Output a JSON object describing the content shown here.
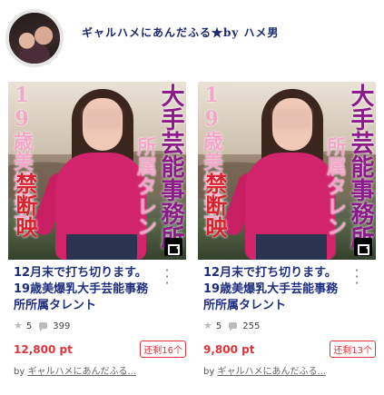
{
  "header": {
    "shop_name": "ギャルハメにあんだふる★by ハメ男"
  },
  "items": [
    {
      "image_overlay": {
        "left_top": "19",
        "left_top2": "歳美爆美女",
        "left_bottom": "禁断映",
        "right_top": "大手芸能事務所",
        "right_mid": "所属タレン"
      },
      "title": "12月末で打ち切ります。19歳美爆乳大手芸能事務所所属タレント",
      "rating": "5",
      "comments": "399",
      "price": "12,800 pt",
      "stock": "还剩16个",
      "by_label": "by",
      "seller": "ギャルハメにあんだふる..."
    },
    {
      "image_overlay": {
        "left_top": "19",
        "left_top2": "歳美爆美女",
        "left_bottom": "禁断映",
        "right_top": "大手芸能事務所",
        "right_mid": "所属タレン"
      },
      "title": "12月末で打ち切ります。19歳美爆乳大手芸能事務所所属タレント",
      "rating": "5",
      "comments": "255",
      "price": "9,800 pt",
      "stock": "还剩13个",
      "by_label": "by",
      "seller": "ギャルハメにあんだふる..."
    }
  ],
  "icons": {
    "more": "kebab-menu-icon",
    "rating": "star-icon",
    "comments": "comment-icon",
    "video": "video-camera-icon"
  },
  "colors": {
    "title": "#1f2f80",
    "price": "#e0333b",
    "shop_name": "#1a2a6c"
  }
}
